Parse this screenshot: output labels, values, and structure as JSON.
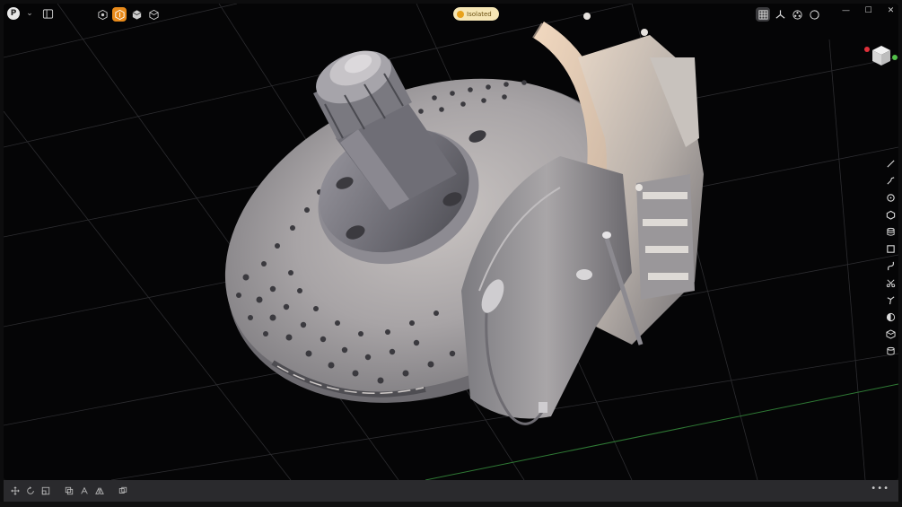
{
  "app": {
    "avatar_letter": "P",
    "accent_color": "#e88a1a",
    "background_color": "#050506"
  },
  "header": {
    "account_chevron": "chevron-down-icon",
    "panel_toggle": "panel-toggle-icon",
    "modes": [
      {
        "icon": "part-icon",
        "active": false
      },
      {
        "icon": "component-icon",
        "active": true
      },
      {
        "icon": "assembly-icon",
        "active": false
      },
      {
        "icon": "box-icon",
        "active": false
      }
    ],
    "isolation_badge": "Isolated",
    "view_tools": [
      {
        "icon": "grid-icon",
        "active": true
      },
      {
        "icon": "axes-icon",
        "active": false
      },
      {
        "icon": "materials-icon",
        "active": false
      },
      {
        "icon": "sphere-icon",
        "active": false
      }
    ],
    "window_controls": [
      "minimize-icon",
      "maximize-icon",
      "close-icon"
    ]
  },
  "tool_rail": [
    "line-icon",
    "polyline-icon",
    "circle-icon",
    "polygon-icon",
    "stack-icon",
    "rectangle-icon",
    "spline-icon",
    "scissors-icon",
    "branch-icon",
    "half-circle-icon",
    "cube-icon",
    "cylinder-icon"
  ],
  "bottom_tools": [
    "move-icon",
    "rotate-icon",
    "scale-icon",
    "duplicate-icon",
    "transform-icon",
    "mirror-icon",
    "group-icon"
  ],
  "bottom_more": "•••"
}
